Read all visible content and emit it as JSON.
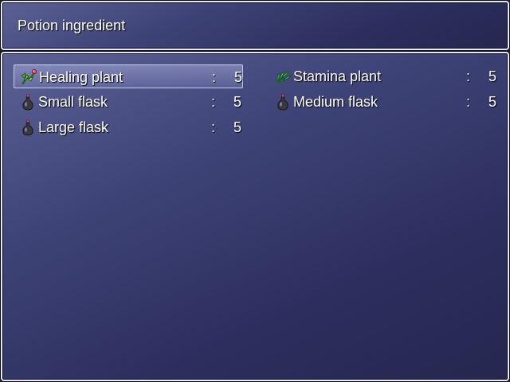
{
  "window": {
    "title": "Potion ingredient"
  },
  "items": [
    {
      "name": "Healing plant",
      "separator": ":",
      "quantity": "5",
      "icon": "healing-plant-icon",
      "selected": true
    },
    {
      "name": "Stamina plant",
      "separator": ":",
      "quantity": "5",
      "icon": "stamina-plant-icon",
      "selected": false
    },
    {
      "name": "Small flask",
      "separator": ":",
      "quantity": "5",
      "icon": "flask-icon",
      "selected": false
    },
    {
      "name": "Medium flask",
      "separator": ":",
      "quantity": "5",
      "icon": "flask-icon",
      "selected": false
    },
    {
      "name": "Large flask",
      "separator": ":",
      "quantity": "5",
      "icon": "flask-icon",
      "selected": false
    }
  ],
  "colors": {
    "window_top": "#5c6296",
    "window_bottom": "#25274f",
    "text": "#ffffff",
    "highlight_border": "#c8ccee"
  }
}
